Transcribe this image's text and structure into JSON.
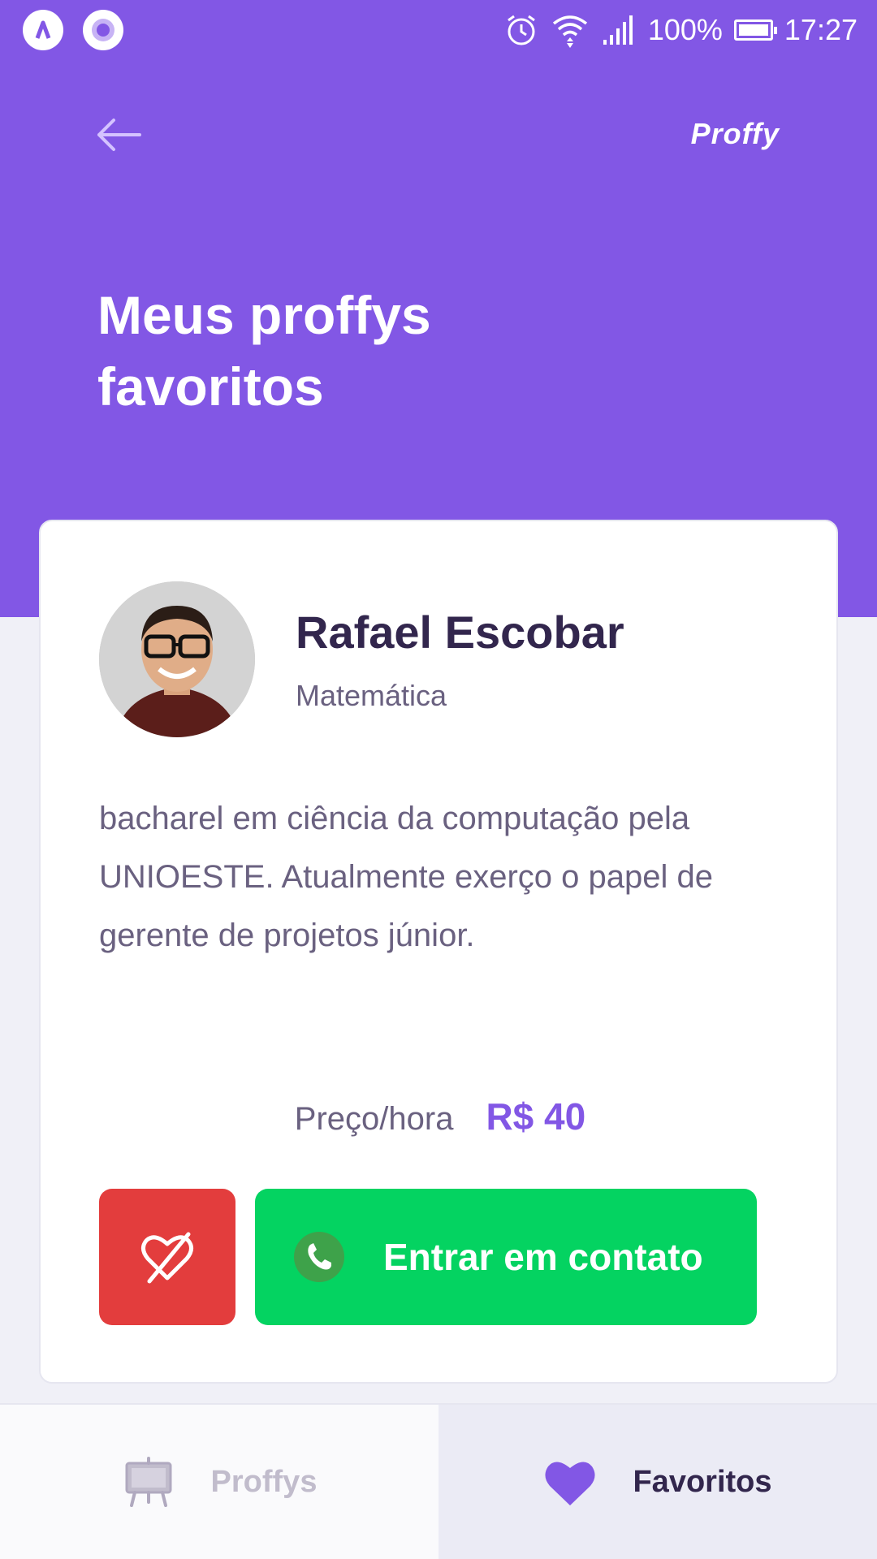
{
  "status_bar": {
    "battery": "100%",
    "time": "17:27",
    "icons": [
      "app-a-icon",
      "app-circle-icon",
      "alarm-icon",
      "wifi-icon",
      "signal-icon",
      "battery-icon"
    ]
  },
  "header": {
    "logo": "Proffy",
    "title": "Meus proffys favoritos",
    "back_icon": "arrow-left-icon"
  },
  "teacher": {
    "name": "Rafael Escobar",
    "subject": "Matemática",
    "bio": "bacharel em ciência da computação pela UNIOESTE. Atualmente exerço o papel de gerente de projetos júnior.",
    "price_label": "Preço/hora",
    "price": "R$ 40",
    "contact_label": "Entrar em contato",
    "unfavorite_icon": "heart-outline-icon",
    "contact_icon": "whatsapp-icon"
  },
  "tabs": [
    {
      "label": "Proffys",
      "icon": "easel-icon",
      "active": false
    },
    {
      "label": "Favoritos",
      "icon": "heart-icon",
      "active": true
    }
  ],
  "colors": {
    "primary": "#8257e5",
    "danger": "#e33d3d",
    "success": "#04d361",
    "title": "#32264d",
    "text": "#6a6180"
  }
}
